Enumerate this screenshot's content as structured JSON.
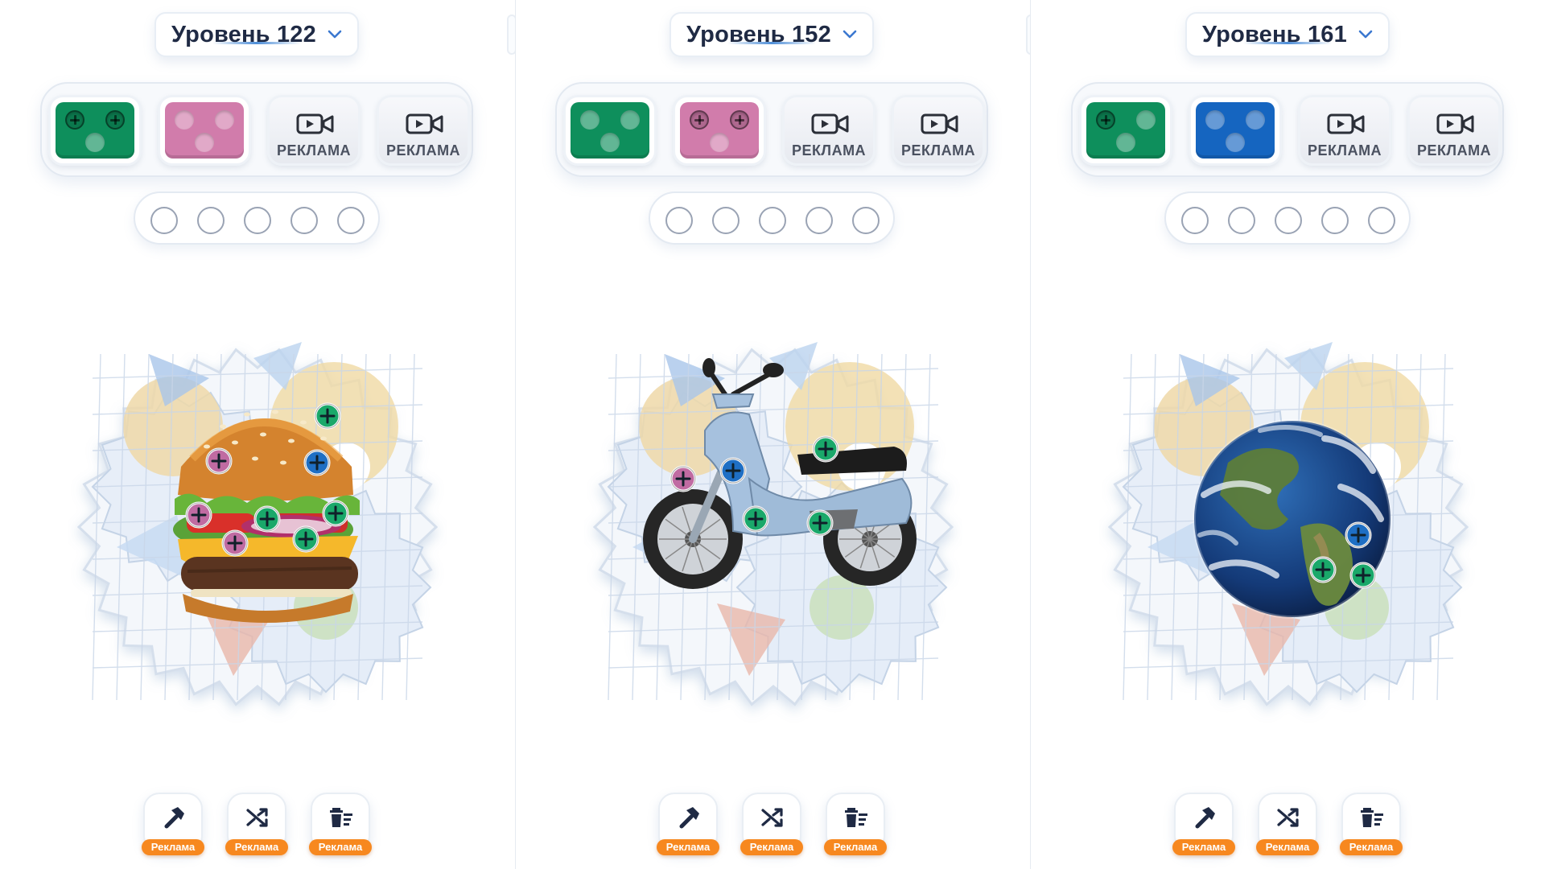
{
  "panels": [
    {
      "level_label": "Уровень 122",
      "pieces": [
        {
          "color": "#0e8f5c",
          "holes": [
            "plus",
            "plus",
            "plain"
          ]
        },
        {
          "color": "#d17cab",
          "holes": [
            "plain",
            "plain",
            "plain"
          ]
        }
      ],
      "ad_slots": [
        {
          "label": "РЕКЛАМА"
        },
        {
          "label": "РЕКЛАМА"
        }
      ],
      "answer_slots": 5,
      "puzzle_image": "burger",
      "tools": [
        {
          "icon": "hammer-icon",
          "badge": "Реклама"
        },
        {
          "icon": "shuffle-icon",
          "badge": "Реклама"
        },
        {
          "icon": "trash-icon",
          "badge": "Реклама"
        }
      ]
    },
    {
      "level_label": "Уровень 152",
      "pieces": [
        {
          "color": "#0e8f5c",
          "holes": [
            "plain",
            "plain",
            "plain"
          ]
        },
        {
          "color": "#d17cab",
          "holes": [
            "plus",
            "plus",
            "plain"
          ]
        }
      ],
      "ad_slots": [
        {
          "label": "РЕКЛАМА"
        },
        {
          "label": "РЕКЛАМА"
        }
      ],
      "answer_slots": 5,
      "puzzle_image": "scooter",
      "tools": [
        {
          "icon": "hammer-icon",
          "badge": "Реклама"
        },
        {
          "icon": "shuffle-icon",
          "badge": "Реклама"
        },
        {
          "icon": "trash-icon",
          "badge": "Реклама"
        }
      ]
    },
    {
      "level_label": "Уровень 161",
      "pieces": [
        {
          "color": "#0e8f5c",
          "holes": [
            "plus",
            "plain",
            "plain"
          ]
        },
        {
          "color": "#1565c0",
          "holes": [
            "plain",
            "plain",
            "plain"
          ]
        }
      ],
      "ad_slots": [
        {
          "label": "РЕКЛАМА"
        },
        {
          "label": "РЕКЛАМА"
        }
      ],
      "answer_slots": 5,
      "puzzle_image": "earth",
      "tools": [
        {
          "icon": "hammer-icon",
          "badge": "Реклама"
        },
        {
          "icon": "shuffle-icon",
          "badge": "Реклама"
        },
        {
          "icon": "trash-icon",
          "badge": "Реклама"
        }
      ]
    }
  ]
}
